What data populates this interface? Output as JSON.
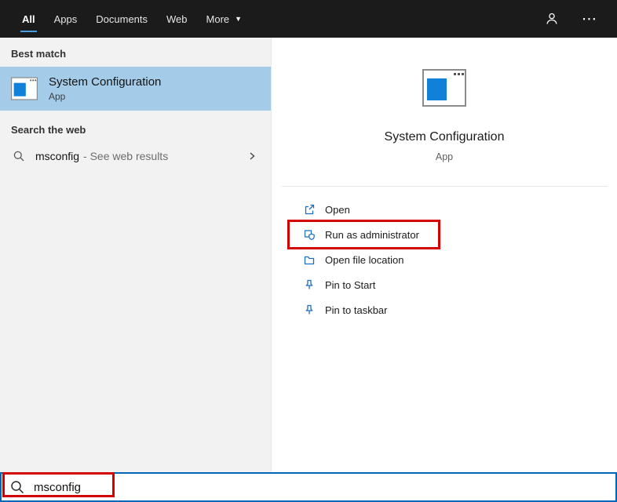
{
  "topbar": {
    "tabs": [
      {
        "label": "All"
      },
      {
        "label": "Apps"
      },
      {
        "label": "Documents"
      },
      {
        "label": "Web"
      },
      {
        "label": "More"
      }
    ],
    "selected_tab": "All"
  },
  "left_panel": {
    "sections": {
      "best_match": "Best match",
      "search_web": "Search the web"
    },
    "best_match_item": {
      "title": "System Configuration",
      "subtitle": "App"
    },
    "web_item": {
      "query": "msconfig",
      "suffix": "- See web results"
    }
  },
  "preview_panel": {
    "app_name": "System Configuration",
    "app_type": "App",
    "actions": [
      {
        "label": "Open"
      },
      {
        "label": "Run as administrator"
      },
      {
        "label": "Open file location"
      },
      {
        "label": "Pin to Start"
      },
      {
        "label": "Pin to taskbar"
      }
    ]
  },
  "search_box": {
    "value": "msconfig"
  },
  "colors": {
    "topbar_bg": "#1b1b1b",
    "accent_blue": "#0078d7",
    "selection_blue": "#a4cbe8",
    "action_icon_blue": "#1a6fc4",
    "annotation_red": "#d40000",
    "app_icon_blue": "#1080d8"
  }
}
